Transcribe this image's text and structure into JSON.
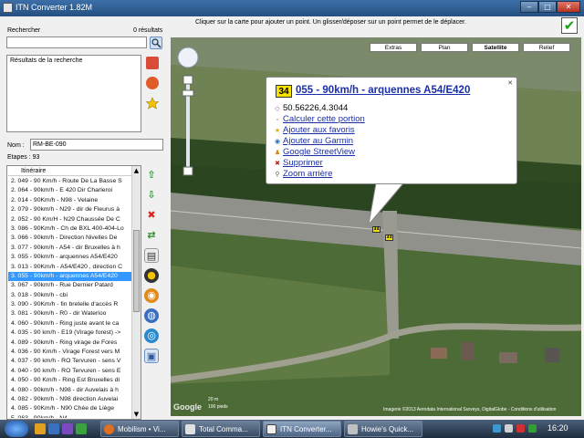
{
  "window": {
    "title": "ITN Converter 1.82M",
    "min": "‒",
    "max": "□",
    "close": "✕"
  },
  "search": {
    "label": "Rechercher",
    "count": "0 résultats",
    "value": "",
    "results_header": "Résultats de la recherche"
  },
  "name": {
    "label": "Nom :",
    "value": "RM-BE-090"
  },
  "steps": {
    "label": "Etapes : 93"
  },
  "itinerary": {
    "header": "Itinéraire",
    "selected_index": 10,
    "rows": [
      "2.  049 - 90 Km/h - Route De La Basse S",
      "2.  064 - 90km/h - E 420 Dir Charleroi",
      "2.  014 - 90Km/h - N98 - Velaine",
      "2.  079 - 90km/h - N29 - dir de Fleurus à",
      "2.  052 - 90 Km/H - N29 Chaussée De C",
      "3.  086 - 90Km/h - Ch de BXL 400-404-Lo",
      "3.  066 - 90km/h - Direction Nivelles De",
      "3.  077 - 90km/h - A54 - dir Bruxelles à h",
      "3.  055 - 90km/h - arquennes A54/E420",
      "3.  013 - 90Km/h - A54/E420 , direction C",
      "3.  055 - 90km/h - arquennes A54/E420",
      "3.  067 - 90km/h - Rue Dernier Patard",
      "3.  018 - 90km/h - cbi",
      "3.  090 - 90Km/h - fin bretelle d'accès R",
      "3.  081 - 90km/h - R0 - dir Waterloo",
      "4.  060 - 90km/h - Ring juste avant le ca",
      "4.  035 - 90 km/h - E19 (Virage forest) ->",
      "4.  089 - 90km/h - Ring virage de Fores",
      "4.  036 - 90 Km/h - Virage Forest vers M",
      "4.  037 - 90 km/h - RO Tervuren - sens V",
      "4.  040 - 90 km/h - RO Tervuren - sens E",
      "4.  050 - 90 Km/h - Ring Est Bruxelles di",
      "4.  080 - 90km/h - N98 - dir Auvelais à h",
      "4.  082 - 90km/h - N98 direction Auvelai",
      "4.  085 - 90Km/h - N90 Chée de Liège",
      "5.  063 - 90km/h - N4",
      "5.  062 - 90km/h - N4"
    ]
  },
  "map": {
    "hint": "Cliquer sur la carte pour ajouter un point. Un glisser/déposer sur un point permet de le déplacer.",
    "types": [
      "Extras",
      "Plan",
      "Satellite",
      "Relief"
    ],
    "active_type": "Satellite",
    "popup": {
      "badge": "34",
      "title": "055 - 90km/h - arquennes A54/E420",
      "coords": "50.56226,4.3044",
      "links": [
        "Calculer cette portion",
        "Ajouter aux favoris",
        "Ajouter au Garmin",
        "Google StreetView",
        "Supprimer",
        "Zoom arrière"
      ]
    },
    "markers": [
      "34",
      "33"
    ],
    "scale": [
      "20 m",
      "100 pieds"
    ],
    "google": "Google",
    "attribution": "Imagerie ©2013 Aerodata International Surveys, DigitalGlobe - Conditions d'utilisation"
  },
  "taskbar": {
    "tasks": [
      "Mobilism • Vi...",
      "Total Comma...",
      "ITN Converter...",
      "Howie's Quick..."
    ],
    "active_task": "ITN Converter...",
    "clock": "16:20"
  },
  "colors": {
    "accent": "#3399ff",
    "badge": "#f5e200",
    "link": "#1a2faa"
  }
}
